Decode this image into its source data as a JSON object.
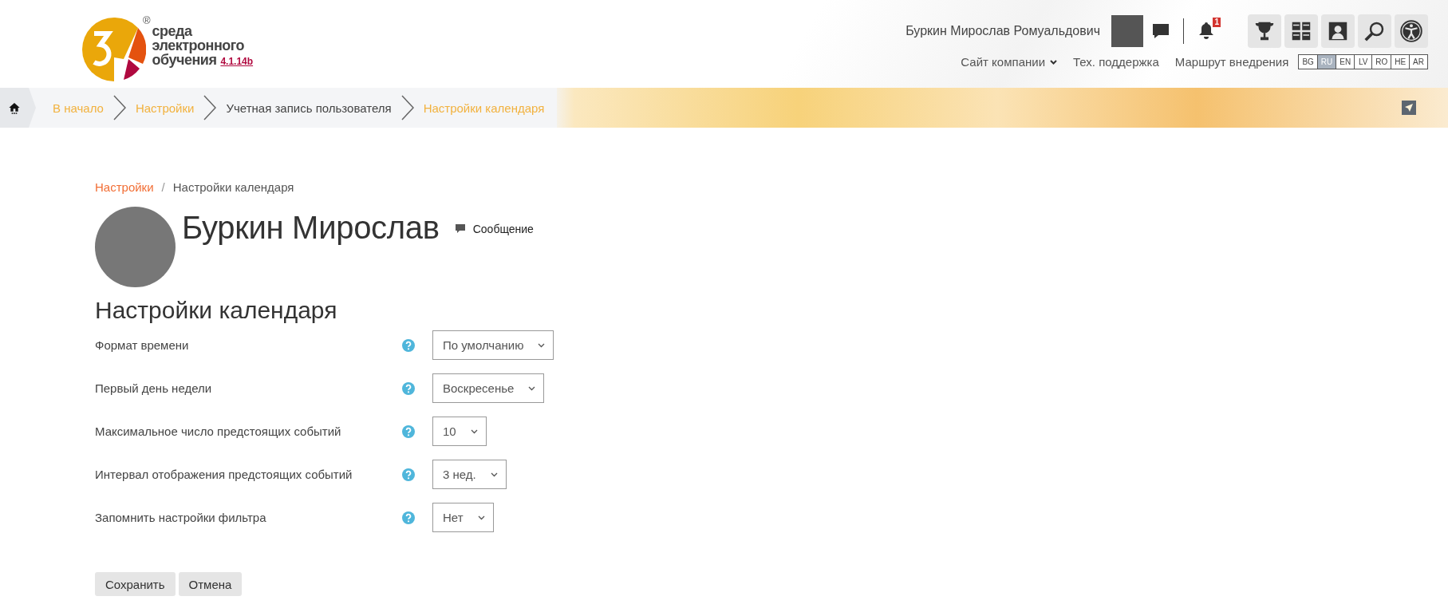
{
  "header": {
    "logo": {
      "registered": "®",
      "lines": [
        "среда",
        "электронного",
        "обучения"
      ],
      "version": "4.1.14b"
    },
    "user": {
      "name": "Буркин Мирослав Ромуальдович",
      "notifications": "1"
    },
    "top_links": [
      {
        "label": "Сайт компании",
        "dropdown": true
      },
      {
        "label": "Тех. поддержка",
        "dropdown": false
      },
      {
        "label": "Маршрут внедрения",
        "dropdown": false
      }
    ],
    "languages": [
      {
        "code": "BG",
        "selected": false
      },
      {
        "code": "RU",
        "selected": true
      },
      {
        "code": "EN",
        "selected": false
      },
      {
        "code": "LV",
        "selected": false
      },
      {
        "code": "RO",
        "selected": false
      },
      {
        "code": "HE",
        "selected": false
      },
      {
        "code": "AR",
        "selected": false
      }
    ]
  },
  "breadcrumb_bar": [
    {
      "label": "В начало",
      "link": true
    },
    {
      "label": "Настройки",
      "link": true
    },
    {
      "label": "Учетная запись пользователя",
      "link": false
    },
    {
      "label": "Настройки календаря",
      "link": true
    }
  ],
  "page_breadcrumb": {
    "separator": "/",
    "items": [
      {
        "label": "Настройки",
        "link": true
      },
      {
        "label": "Настройки календаря",
        "link": false
      }
    ]
  },
  "profile": {
    "name": "Буркин Мирослав",
    "message": "Сообщение"
  },
  "heading": "Настройки календаря",
  "settings": [
    {
      "label": "Формат времени",
      "value": "По умолчанию"
    },
    {
      "label": "Первый день недели",
      "value": "Воскресенье"
    },
    {
      "label": "Максимальное число предстоящих событий",
      "value": "10"
    },
    {
      "label": "Интервал отображения предстоящих событий",
      "value": "3 нед."
    },
    {
      "label": "Запомнить настройки фильтра",
      "value": "Нет"
    }
  ],
  "buttons": [
    "Сохранить",
    "Отмена"
  ]
}
